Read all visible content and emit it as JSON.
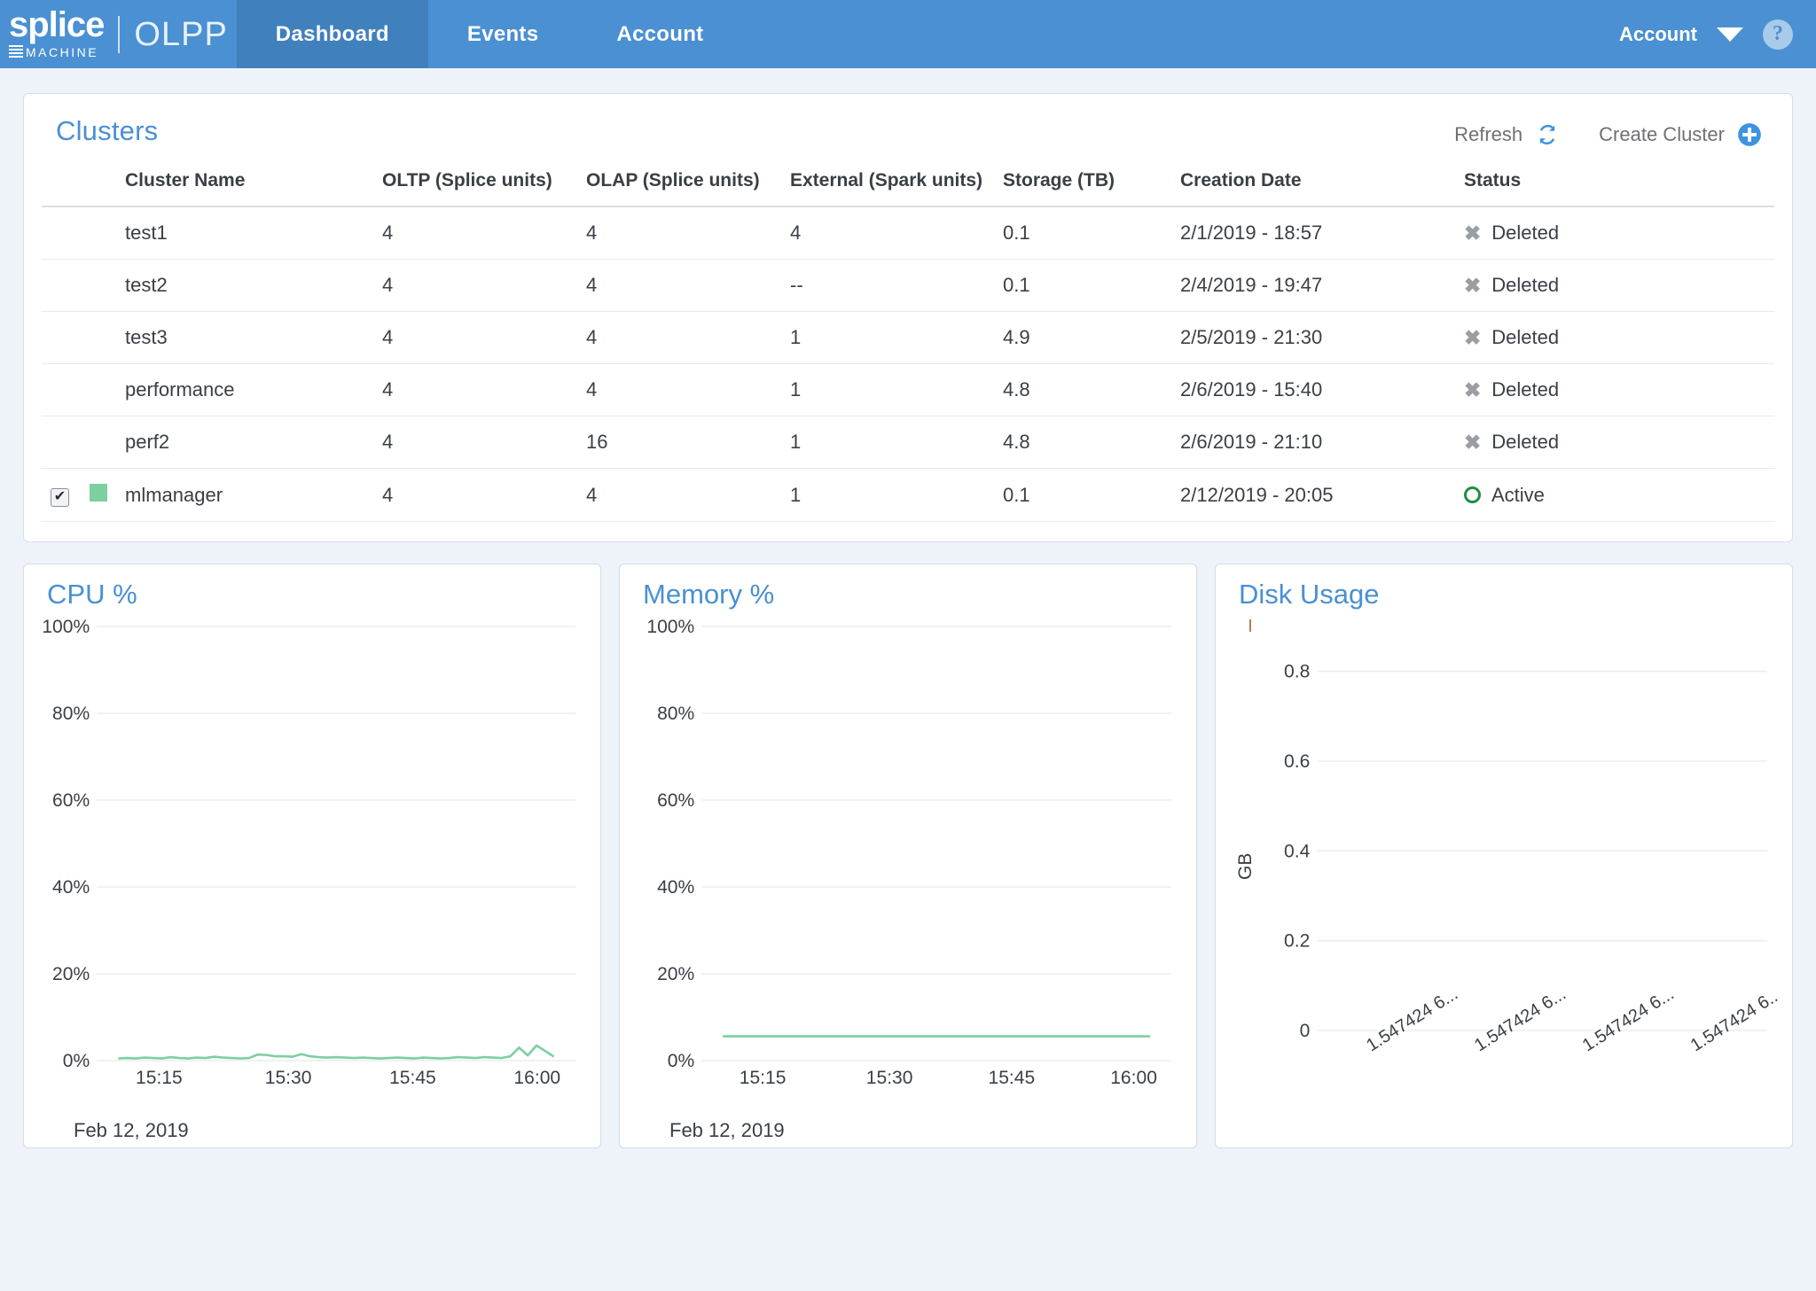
{
  "header": {
    "brand_primary": "splice",
    "brand_secondary": "MACHINE",
    "product": "OLPP",
    "nav": [
      {
        "label": "Dashboard",
        "active": true
      },
      {
        "label": "Events",
        "active": false
      },
      {
        "label": "Account",
        "active": false
      }
    ],
    "account_label": "Account",
    "caret_icon": "chevron-down-icon",
    "help_icon": "help-circle-icon"
  },
  "clusters": {
    "title": "Clusters",
    "refresh_label": "Refresh",
    "refresh_icon": "refresh-icon",
    "create_label": "Create Cluster",
    "create_icon": "plus-circle-icon",
    "columns": [
      "Cluster Name",
      "OLTP (Splice units)",
      "OLAP (Splice units)",
      "External (Spark units)",
      "Storage (TB)",
      "Creation Date",
      "Status"
    ],
    "rows": [
      {
        "selected": false,
        "dot": false,
        "name": "test1",
        "oltp": "4",
        "olap": "4",
        "external": "4",
        "storage": "0.1",
        "created": "2/1/2019 - 18:57",
        "status": "Deleted",
        "status_icon": "x-icon"
      },
      {
        "selected": false,
        "dot": false,
        "name": "test2",
        "oltp": "4",
        "olap": "4",
        "external": "--",
        "storage": "0.1",
        "created": "2/4/2019 - 19:47",
        "status": "Deleted",
        "status_icon": "x-icon"
      },
      {
        "selected": false,
        "dot": false,
        "name": "test3",
        "oltp": "4",
        "olap": "4",
        "external": "1",
        "storage": "4.9",
        "created": "2/5/2019 - 21:30",
        "status": "Deleted",
        "status_icon": "x-icon"
      },
      {
        "selected": false,
        "dot": false,
        "name": "performance",
        "oltp": "4",
        "olap": "4",
        "external": "1",
        "storage": "4.8",
        "created": "2/6/2019 - 15:40",
        "status": "Deleted",
        "status_icon": "x-icon"
      },
      {
        "selected": false,
        "dot": false,
        "name": "perf2",
        "oltp": "4",
        "olap": "16",
        "external": "1",
        "storage": "4.8",
        "created": "2/6/2019 - 21:10",
        "status": "Deleted",
        "status_icon": "x-icon"
      },
      {
        "selected": true,
        "dot": true,
        "name": "mlmanager",
        "oltp": "4",
        "olap": "4",
        "external": "1",
        "storage": "0.1",
        "created": "2/12/2019 - 20:05",
        "status": "Active",
        "status_icon": "circle-icon"
      }
    ]
  },
  "colors": {
    "brand_blue": "#4a90d2",
    "nav_active": "#4080bd",
    "link_blue": "#3a7fc1",
    "series_green": "#7dcfa0",
    "active_green": "#1f8f3d",
    "grid_gray": "#ebedef"
  },
  "chart_data": [
    {
      "type": "line",
      "title": "CPU %",
      "xlabel": "Feb 12, 2019",
      "ylabel": "",
      "ylim": [
        0,
        100
      ],
      "yticks": [
        "0%",
        "20%",
        "40%",
        "60%",
        "80%",
        "100%"
      ],
      "ytick_values": [
        0,
        20,
        40,
        60,
        80,
        100
      ],
      "xticks": [
        "15:15",
        "15:30",
        "15:45",
        "16:00"
      ],
      "xtick_positions": [
        0.13,
        0.4,
        0.66,
        0.92
      ],
      "grid": true,
      "legend": "none",
      "series": [
        {
          "name": "CPU %",
          "color": "#7dcfa0",
          "x": [
            0,
            2,
            4,
            6,
            8,
            10,
            12,
            14,
            16,
            18,
            20,
            22,
            24,
            26,
            28,
            30,
            32,
            34,
            36,
            38,
            40,
            42,
            44,
            46,
            48,
            50,
            52,
            54,
            56,
            58,
            60,
            62,
            64,
            66,
            68,
            70,
            72,
            74,
            76,
            78,
            80,
            82,
            84,
            86,
            88,
            90,
            92,
            94,
            96,
            98,
            100
          ],
          "values": [
            0.5,
            0.6,
            0.5,
            0.7,
            0.6,
            0.5,
            0.8,
            0.6,
            0.5,
            0.7,
            0.6,
            0.9,
            0.7,
            0.6,
            0.5,
            0.6,
            1.4,
            1.3,
            1.0,
            1.0,
            0.9,
            1.5,
            1.0,
            0.8,
            0.7,
            0.8,
            0.7,
            0.6,
            0.7,
            0.6,
            0.5,
            0.6,
            0.7,
            0.6,
            0.5,
            0.7,
            0.6,
            0.5,
            0.6,
            0.8,
            0.7,
            0.6,
            0.8,
            0.7,
            0.6,
            1.0,
            3.0,
            1.2,
            3.5,
            2.2,
            0.9
          ]
        }
      ]
    },
    {
      "type": "line",
      "title": "Memory %",
      "xlabel": "Feb 12, 2019",
      "ylabel": "",
      "ylim": [
        0,
        100
      ],
      "yticks": [
        "0%",
        "20%",
        "40%",
        "60%",
        "80%",
        "100%"
      ],
      "ytick_values": [
        0,
        20,
        40,
        60,
        80,
        100
      ],
      "xticks": [
        "15:15",
        "15:30",
        "15:45",
        "16:00"
      ],
      "xtick_positions": [
        0.13,
        0.4,
        0.66,
        0.92
      ],
      "grid": true,
      "legend": "none",
      "series": [
        {
          "name": "Memory %",
          "color": "#7dcfa0",
          "x": [
            0,
            10,
            20,
            30,
            40,
            50,
            60,
            70,
            80,
            90,
            100
          ],
          "values": [
            5.6,
            5.6,
            5.6,
            5.6,
            5.6,
            5.6,
            5.6,
            5.6,
            5.6,
            5.6,
            5.6
          ]
        }
      ]
    },
    {
      "type": "line",
      "title": "Disk Usage",
      "xlabel": "",
      "ylabel": "GB",
      "ylim": [
        0,
        0.9
      ],
      "yticks": [
        "0",
        "0.2",
        "0.4",
        "0.6",
        "0.8"
      ],
      "ytick_values": [
        0,
        0.2,
        0.4,
        0.6,
        0.8
      ],
      "xticks": [
        "1.547424 6...",
        "1.547424 6...",
        "1.547424 6...",
        "1.547424 6..."
      ],
      "xtick_positions": [
        0.12,
        0.36,
        0.6,
        0.84
      ],
      "xtick_rotation": -32,
      "grid": true,
      "legend": "none",
      "series": [
        {
          "name": "Disk Usage",
          "color": "#b08050",
          "x": [],
          "values": []
        }
      ]
    }
  ]
}
